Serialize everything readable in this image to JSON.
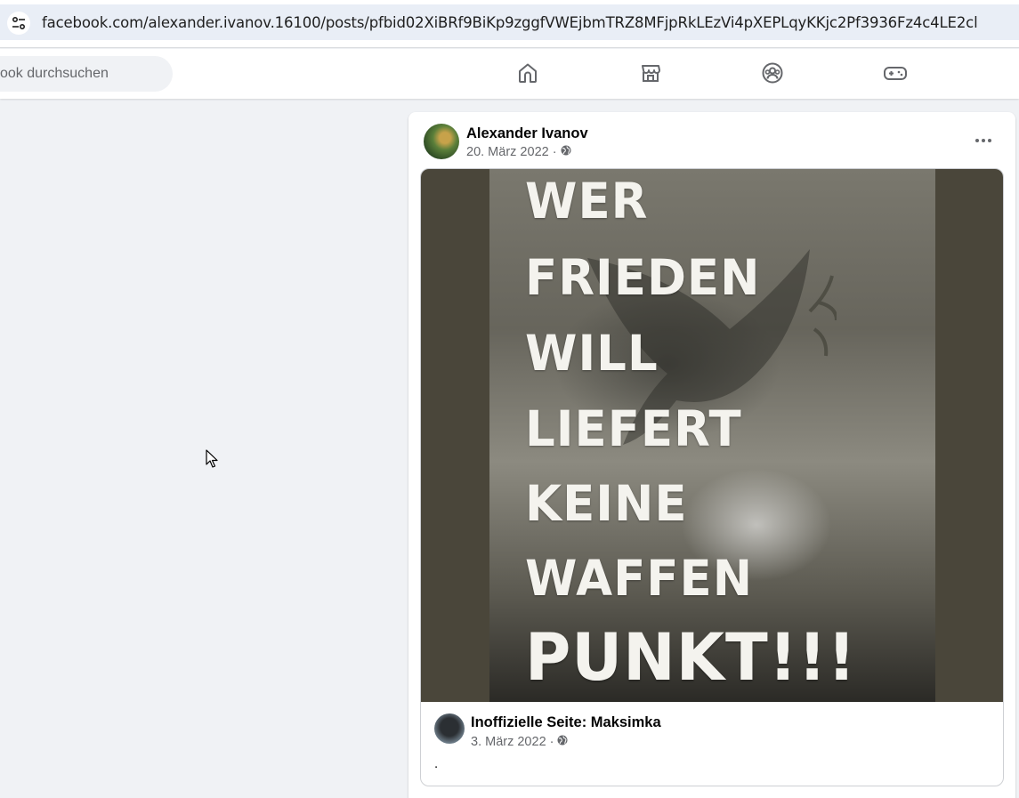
{
  "browser": {
    "url": "facebook.com/alexander.ivanov.16100/posts/pfbid02XiBRf9BiKp9zggfVWEjbmTRZ8MFjpRkLEzVi4pXEPLqyKKjc2Pf3936Fz4c4LE2cl",
    "site_settings_icon": "tune-icon"
  },
  "header": {
    "search_placeholder": "ook durchsuchen",
    "nav": [
      {
        "name": "home-icon"
      },
      {
        "name": "marketplace-icon"
      },
      {
        "name": "groups-icon"
      },
      {
        "name": "gaming-icon"
      }
    ]
  },
  "post": {
    "author": "Alexander Ivanov",
    "date": "20. März 2022",
    "separator": " · ",
    "privacy_icon": "globe-icon",
    "more_icon": "more-icon",
    "shared": {
      "image_lines": [
        "WER",
        "FRIEDEN",
        "WILL",
        "LIEFERT",
        "KEINE",
        "WAFFEN",
        "PUNKT!!!"
      ],
      "source_name": "Inoffizielle Seite: Maksimka",
      "source_date": "3. März 2022",
      "source_text": "."
    }
  },
  "colors": {
    "fb_background": "#f0f2f5",
    "text_primary": "#050505",
    "text_secondary": "#65676b",
    "address_bar": "#e9eef6"
  }
}
